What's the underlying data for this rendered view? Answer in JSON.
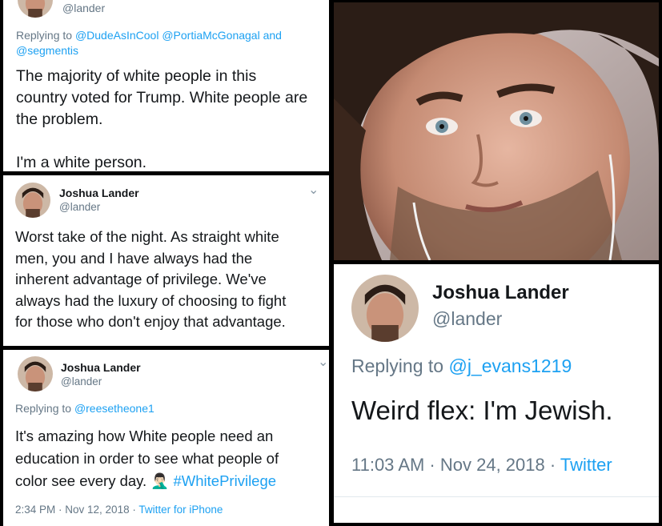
{
  "tweet1": {
    "handle": "@lander",
    "replying_prefix": "Replying to ",
    "reply_user_1": "@DudeAsInCool",
    "reply_user_2": "@PortiaMcGonagal",
    "reply_and": " and",
    "reply_user_3": "@segmentis",
    "line1": "The majority of white people in this",
    "line2": "country voted for Trump. White people are",
    "line3": "the problem.",
    "line4": "I'm a white person."
  },
  "tweet2": {
    "name": "Joshua Lander",
    "handle": "@lander",
    "chevron": "⌄",
    "lines": [
      "Worst take of the night. As straight white",
      "men, you and I have always had the",
      "inherent advantage of privilege. We've",
      "always had the luxury of choosing to fight",
      "for those who don't enjoy that advantage."
    ]
  },
  "tweet3": {
    "name": "Joshua Lander",
    "handle": "@lander",
    "chevron": "⌄",
    "replying_prefix": "Replying to ",
    "reply_user": "@reesetheone1",
    "line1": "It's amazing how White people need an",
    "line2": "education in order to see what people of",
    "line3": "color see every day. ",
    "emoji": "🤦🏻‍♂️",
    "hashtag": "#WhitePrivilege",
    "timestamp": "2:34 PM · Nov 12, 2018 · ",
    "source": "Twitter for iPhone"
  },
  "photo": {
    "subject": "man-selfie",
    "skin": "#c9937a",
    "hair": "#2b1d16"
  },
  "tweet4": {
    "name": "Joshua Lander",
    "handle": "@lander",
    "replying_prefix": "Replying to ",
    "reply_user": "@j_evans1219",
    "text": "Weird flex: I'm Jewish.",
    "timestamp": "11:03 AM · Nov 24, 2018 · ",
    "source": "Twitter"
  },
  "colors": {
    "link": "#1da1f2",
    "secondary": "#657786",
    "text": "#14171a"
  }
}
